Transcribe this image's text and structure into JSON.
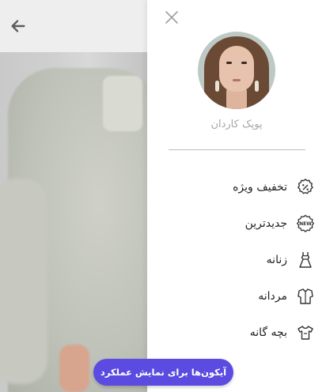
{
  "drawer": {
    "user_name": "پوپک کاردان",
    "items": [
      {
        "label": "تخفیف ویژه",
        "icon": "percent-badge-icon"
      },
      {
        "label": "جدیدترین",
        "icon": "new-badge-icon"
      },
      {
        "label": "زنانه",
        "icon": "dress-icon"
      },
      {
        "label": "مردانه",
        "icon": "shirt-icon"
      },
      {
        "label": "بچه گانه",
        "icon": "kids-tshirt-icon"
      }
    ]
  },
  "fab": {
    "label": "آیکون‌ها برای نمایش عملکرد"
  },
  "colors": {
    "accent": "#5b4be0",
    "divider": "#bdbdbd",
    "muted_text": "#a6a6a6"
  }
}
